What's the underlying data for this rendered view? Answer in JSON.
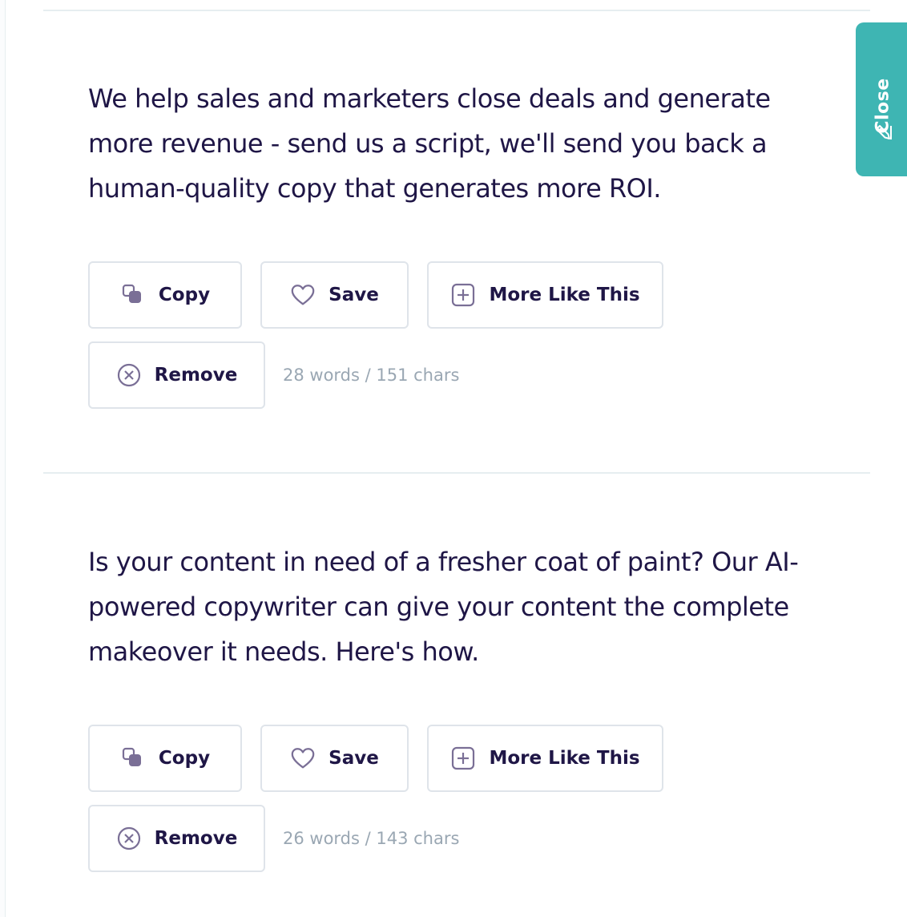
{
  "close_tab": {
    "label": "Close",
    "icon": "pencil-icon"
  },
  "results": [
    {
      "text": "We help sales and marketers close deals and generate more revenue - send us a script, we'll send you back a human-quality copy that generates more ROI.",
      "copy_label": "Copy",
      "save_label": "Save",
      "more_label": "More Like This",
      "remove_label": "Remove",
      "stats": "28 words / 151 chars"
    },
    {
      "text": "Is your content in need of a fresher coat of paint? Our AI-powered copywriter can give your content the complete makeover it needs. Here's how.",
      "copy_label": "Copy",
      "save_label": "Save",
      "more_label": "More Like This",
      "remove_label": "Remove",
      "stats": "26 words / 143 chars"
    }
  ],
  "icons": {
    "copy": "copy-icon",
    "save": "heart-icon",
    "more": "plus-square-icon",
    "remove": "x-circle-icon"
  },
  "colors": {
    "text": "#1f1646",
    "muted": "#9aa7b3",
    "accent": "#3eb5b3",
    "icon": "#7a6f96",
    "border": "#dfe4ea"
  }
}
